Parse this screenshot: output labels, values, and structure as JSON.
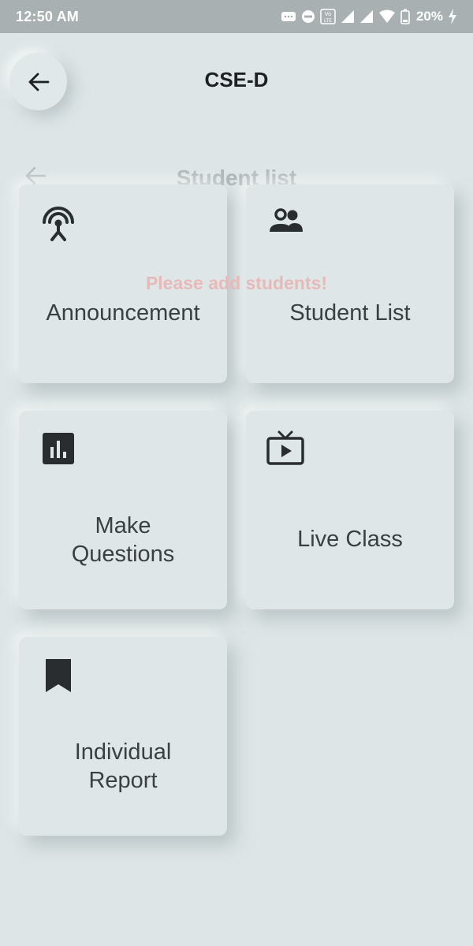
{
  "status_bar": {
    "time": "12:50 AM",
    "battery": "20%",
    "icons": [
      "chat-icon",
      "dnd-icon",
      "volte-icon",
      "signal-icon",
      "signal-icon",
      "wifi-icon",
      "battery-icon",
      "charging-icon"
    ]
  },
  "header": {
    "title": "CSE-D",
    "back_icon": "arrow-left-icon"
  },
  "overlay": {
    "title": "Student list",
    "message": "Please add students!",
    "message_color": "#e7b9b9"
  },
  "cards": [
    {
      "label": "Announcement",
      "icon": "broadcast-icon"
    },
    {
      "label": "Student List",
      "icon": "people-icon"
    },
    {
      "label_line1": "Make",
      "label_line2": "Questions",
      "icon": "bar-chart-icon"
    },
    {
      "label": "Live Class",
      "icon": "tv-play-icon"
    },
    {
      "label_line1": "Individual",
      "label_line2": "Report",
      "icon": "bookmark-icon"
    }
  ],
  "colors": {
    "background": "#dde5e6",
    "status_bar": "#a8b0b2",
    "card": "#dfe6e7",
    "text": "#3a3f42"
  }
}
